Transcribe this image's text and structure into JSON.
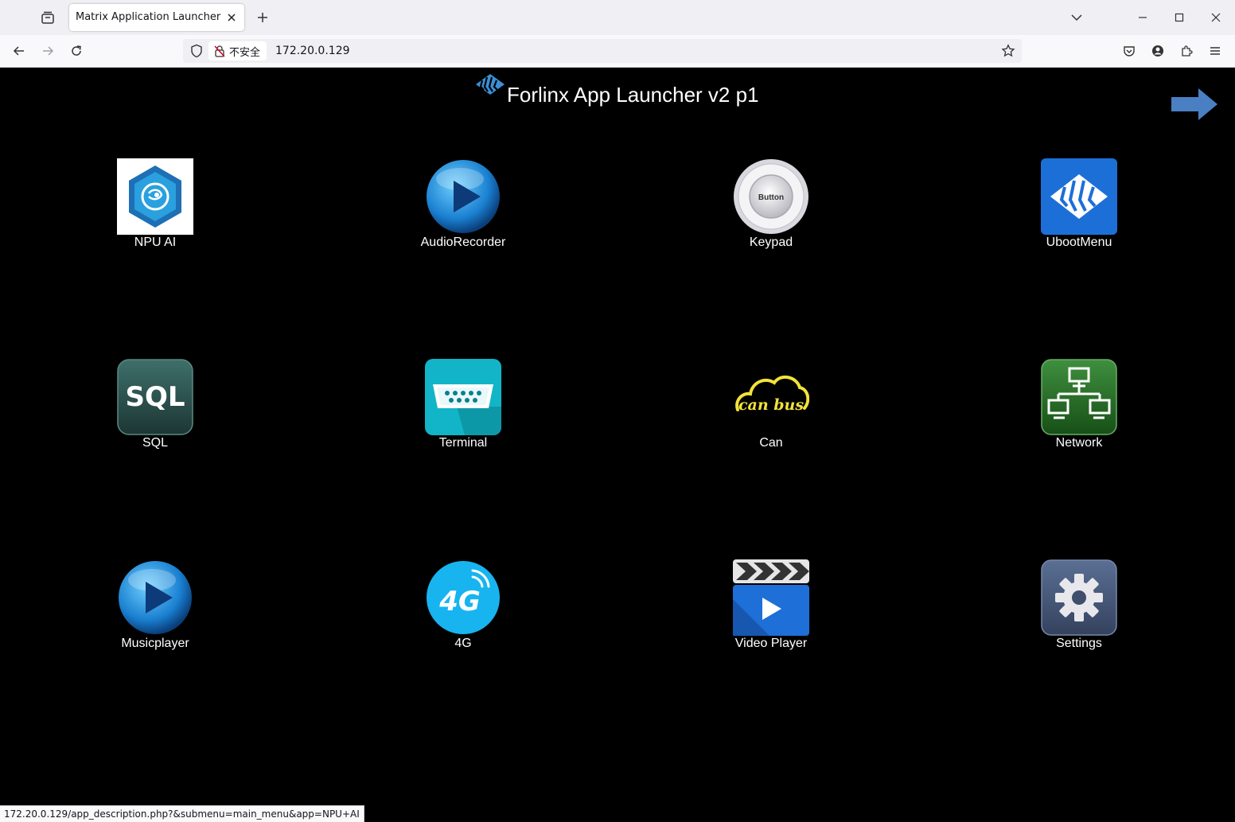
{
  "browser": {
    "tab_title": "Matrix Application Launcher",
    "security_label": "不安全",
    "url": "172.20.0.129",
    "status_url": "172.20.0.129/app_description.php?&submenu=main_menu&app=NPU+AI"
  },
  "page": {
    "title": "Forlinx App Launcher v2 p1"
  },
  "apps": [
    {
      "label": "NPU AI",
      "icon": "npu-ai-icon"
    },
    {
      "label": "AudioRecorder",
      "icon": "play-orb-icon"
    },
    {
      "label": "Keypad",
      "icon": "button-icon"
    },
    {
      "label": "UbootMenu",
      "icon": "forlinx-logo-icon"
    },
    {
      "label": "SQL",
      "icon": "sql-icon",
      "icon_text": "SQL"
    },
    {
      "label": "Terminal",
      "icon": "serial-port-icon"
    },
    {
      "label": "Can",
      "icon": "canbus-cloud-icon",
      "icon_text": "can bus"
    },
    {
      "label": "Network",
      "icon": "network-icon"
    },
    {
      "label": "Musicplayer",
      "icon": "play-orb-icon"
    },
    {
      "label": "4G",
      "icon": "4g-icon",
      "icon_text": "4G"
    },
    {
      "label": "Video Player",
      "icon": "clapperboard-icon"
    },
    {
      "label": "Settings",
      "icon": "gear-icon"
    }
  ],
  "keypad_icon_text": "Button"
}
